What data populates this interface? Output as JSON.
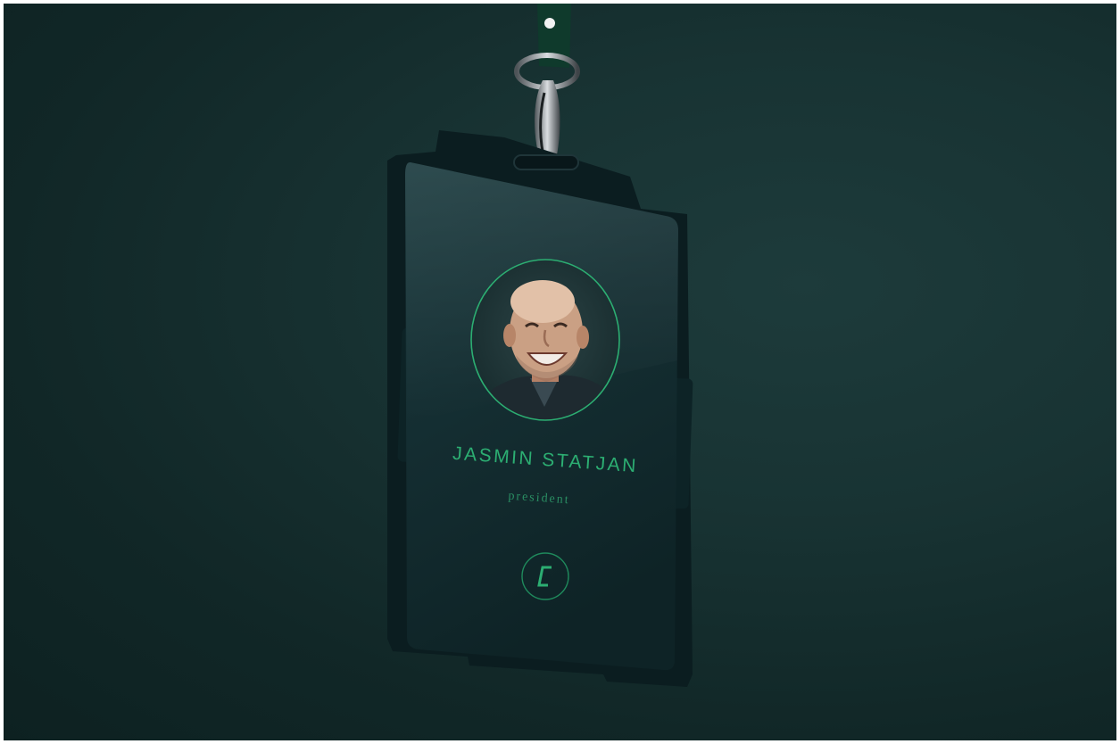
{
  "badge": {
    "name": "JASMIN STATJAN",
    "role": "president",
    "logo_icon": "bracket-c-logo-icon",
    "photo_icon": "smiling-man-portrait",
    "accent_color": "#2cae72"
  },
  "scene": {
    "background_color": "#163030",
    "lanyard_color": "#0f3a2c"
  }
}
